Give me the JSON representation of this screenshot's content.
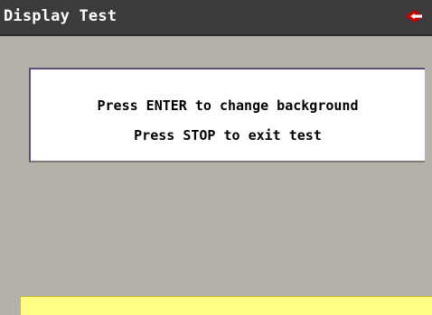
{
  "window": {
    "title": "Display Test",
    "logo_icon": "brand-logo-icon"
  },
  "message": {
    "line1": "Press ENTER to change background",
    "line2": "Press STOP to exit test"
  },
  "colors": {
    "background": "#b3b1a8",
    "titlebar": "#3c3a3d",
    "message_box": "#ffffff",
    "status_bar": "#fffd84",
    "logo": "#c80000"
  }
}
